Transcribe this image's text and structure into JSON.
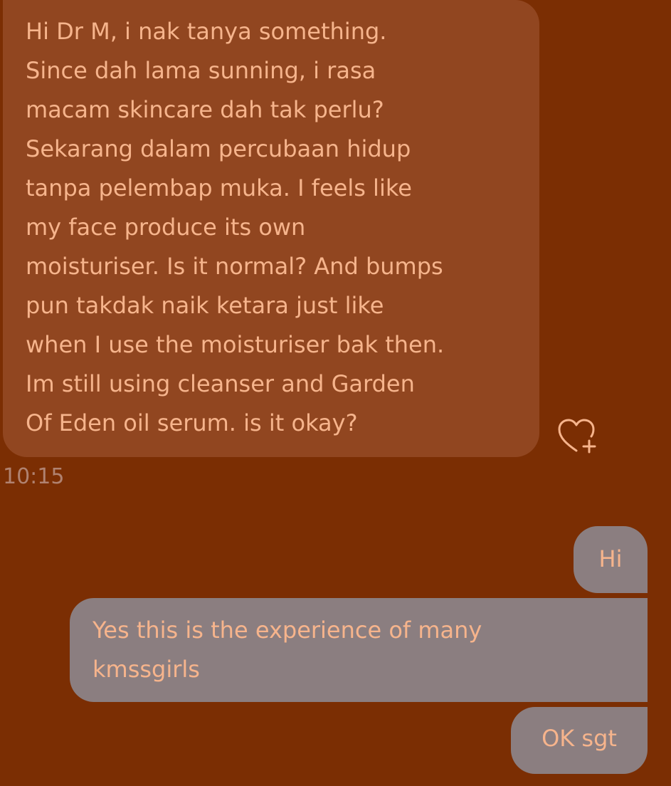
{
  "conversation": {
    "incoming_message": {
      "text": "Hi Dr M, i nak tanya something.\nSince dah lama sunning, i rasa\nmacam skincare dah tak perlu?\nSekarang dalam percubaan hidup\ntanpa pelembap muka. I feels like\nmy face produce its own\nmoisturiser. Is it normal? And bumps\npun takdak naik ketara just like\nwhen I use the moisturiser bak then.\nIm still using cleanser and Garden\nOf Eden oil serum. is it okay?",
      "timestamp": "10:15",
      "react_icon": "heart-plus-icon"
    },
    "outgoing_messages": [
      {
        "text": "Hi"
      },
      {
        "text": "Yes this is the experience of many\nkmssgirls"
      },
      {
        "text": "OK sgt"
      }
    ]
  },
  "colors": {
    "background": "#7b2e03",
    "incoming_bubble": "#914620",
    "outgoing_bubble": "#8b7e80",
    "message_text": "#f6b48c"
  }
}
